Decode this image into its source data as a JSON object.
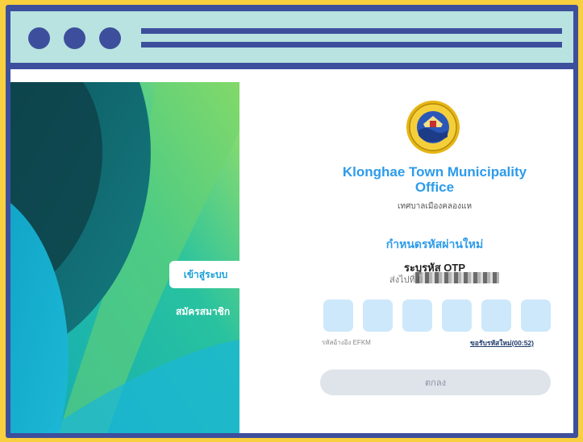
{
  "window": {
    "accent": "#3d4f9c",
    "background": "#f7cf3f"
  },
  "sidebar": {
    "login_tab": "เข้าสู่ระบบ",
    "register_tab": "สมัครสมาชิก"
  },
  "org": {
    "name": "Klonghae Town Municipality Office",
    "name_line1": "Klonghae Town Municipality",
    "name_line2": "Office",
    "thai_name": "เทศบาลเมืองคลองแห",
    "seal_icon": "municipality-seal-icon"
  },
  "form": {
    "title": "กำหนดรหัสผ่านใหม่",
    "otp_label": "ระบุรหัส OTP",
    "sent_to": "ส่งไปที่ 0",
    "otp_digits": [
      "",
      "",
      "",
      "",
      "",
      ""
    ],
    "ref_text": "รหัสอ้างอิง EFKM",
    "resend_text": "ขอรับรหัสใหม่(00:52)",
    "submit_label": "ตกลง"
  }
}
